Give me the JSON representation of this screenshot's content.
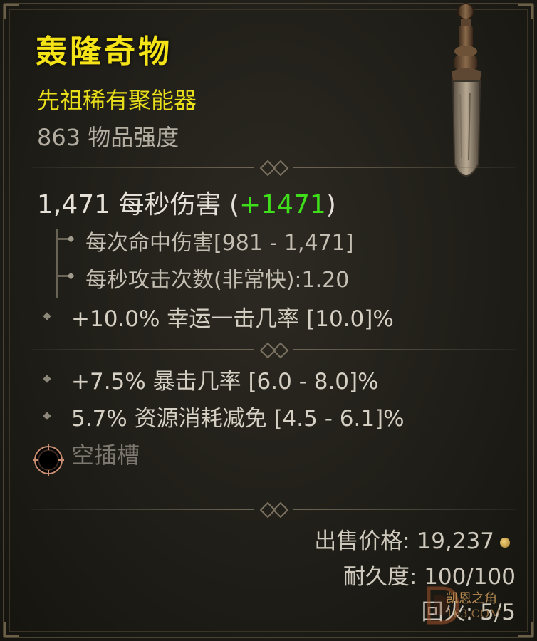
{
  "item": {
    "name": "轰隆奇物",
    "type": "先祖稀有聚能器",
    "power": "863 物品强度"
  },
  "damage": {
    "dps_prefix": "1,471 每秒伤害 (",
    "dps_bonus": "+1471",
    "dps_suffix": ")",
    "per_hit": "每次命中伤害[981 - 1,471]",
    "attack_speed": "每秒攻击次数(非常快):1.20"
  },
  "affixes": {
    "lucky_hit": "+10.0% 幸运一击几率 [10.0]%",
    "crit": "+7.5% 暴击几率 [6.0 - 8.0]%",
    "resource": "5.7% 资源消耗减免 [4.5 - 6.1]%"
  },
  "socket": {
    "label": "空插槽"
  },
  "footer": {
    "sell_label": "出售价格:",
    "sell_value": "19,237",
    "durability_label": "耐久度:",
    "durability_value": "100/100",
    "charges_label": "回火:",
    "charges_value": "5/5"
  },
  "watermark": {
    "text": "凯恩之角",
    "sub": "163.COM"
  },
  "colors": {
    "title": "#f4e316",
    "rarity": "#e8de1a",
    "bonus": "#3ede1a"
  }
}
